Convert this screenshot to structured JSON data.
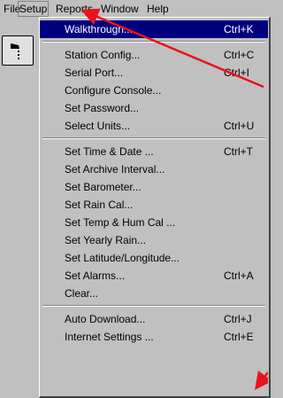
{
  "menubar": [
    {
      "label": "File",
      "u": "F"
    },
    {
      "label": "Setup",
      "u": "S"
    },
    {
      "label": "Reports",
      "u": "R"
    },
    {
      "label": "Window",
      "u": "W"
    },
    {
      "label": "Help",
      "u": "H"
    }
  ],
  "menu": [
    {
      "label": "Walkthrough...",
      "shortcut": "Ctrl+K",
      "highlighted": true
    },
    {
      "sep": true
    },
    {
      "label": "Station Config...",
      "shortcut": "Ctrl+C"
    },
    {
      "label": "Serial Port...",
      "shortcut": "Ctrl+I"
    },
    {
      "label": "Configure Console...",
      "shortcut": ""
    },
    {
      "label": "Set Password...",
      "shortcut": ""
    },
    {
      "label": "Select Units...",
      "shortcut": "Ctrl+U"
    },
    {
      "sep": true
    },
    {
      "label": "Set Time & Date ...",
      "shortcut": "Ctrl+T"
    },
    {
      "label": "Set Archive Interval...",
      "shortcut": ""
    },
    {
      "label": "Set Barometer...",
      "shortcut": ""
    },
    {
      "label": "Set Rain Cal...",
      "shortcut": ""
    },
    {
      "label": "Set Temp & Hum Cal ...",
      "shortcut": ""
    },
    {
      "label": "Set Yearly Rain...",
      "shortcut": ""
    },
    {
      "label": "Set Latitude/Longitude...",
      "shortcut": ""
    },
    {
      "label": "Set Alarms...",
      "shortcut": "Ctrl+A"
    },
    {
      "label": "Clear...",
      "shortcut": ""
    },
    {
      "sep": true
    },
    {
      "label": "Auto Download...",
      "shortcut": "Ctrl+J"
    },
    {
      "label": "Internet Settings ...",
      "shortcut": "Ctrl+E"
    }
  ],
  "colors": {
    "arrow": "#e8141b",
    "highlight": "#000080"
  }
}
